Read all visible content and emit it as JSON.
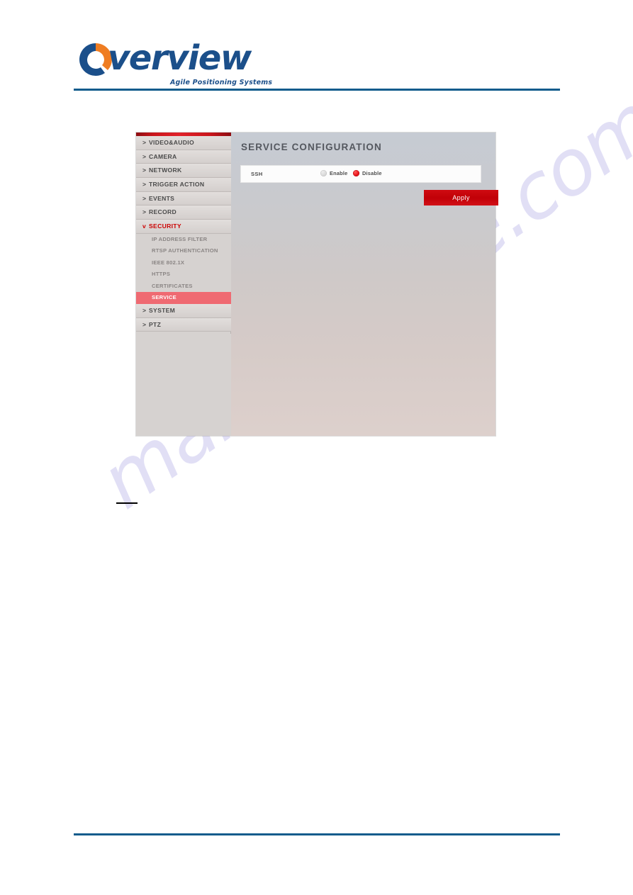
{
  "header": {
    "logo_word": "verview",
    "logo_tagline": "Agile Positioning Systems",
    "logo_icon": "overview-circle-logo"
  },
  "watermark": {
    "text": "manualshive.com"
  },
  "screenshot": {
    "sidebar": {
      "items": [
        {
          "label": "VIDEO&AUDIO",
          "chevron": ">",
          "state": "collapsed"
        },
        {
          "label": "CAMERA",
          "chevron": ">",
          "state": "collapsed"
        },
        {
          "label": "NETWORK",
          "chevron": ">",
          "state": "collapsed"
        },
        {
          "label": "TRIGGER ACTION",
          "chevron": ">",
          "state": "collapsed"
        },
        {
          "label": "EVENTS",
          "chevron": ">",
          "state": "collapsed"
        },
        {
          "label": "RECORD",
          "chevron": ">",
          "state": "collapsed"
        },
        {
          "label": "SECURITY",
          "chevron": "v",
          "state": "expanded"
        },
        {
          "label": "SYSTEM",
          "chevron": ">",
          "state": "collapsed"
        },
        {
          "label": "PTZ",
          "chevron": ">",
          "state": "collapsed"
        }
      ],
      "security_subitems": [
        {
          "label": "IP ADDRESS FILTER",
          "active": false
        },
        {
          "label": "RTSP AUTHENTICATION",
          "active": false
        },
        {
          "label": "IEEE 802.1X",
          "active": false
        },
        {
          "label": "HTTPS",
          "active": false
        },
        {
          "label": "CERTIFICATES",
          "active": false
        },
        {
          "label": "SERVICE",
          "active": true
        }
      ]
    },
    "panel": {
      "title": "SERVICE CONFIGURATION",
      "ssh_row": {
        "label": "SSH",
        "options": [
          {
            "label": "Enable",
            "selected": false
          },
          {
            "label": "Disable",
            "selected": true
          }
        ]
      },
      "apply_label": "Apply"
    }
  },
  "colors": {
    "brand_blue": "#1b4f8a",
    "rule_blue": "#115c8c",
    "accent_red": "#cc0000",
    "apply_red": "#c10007",
    "active_pink": "#ef6a72",
    "sidebar_grey": "#d6d2d0"
  }
}
